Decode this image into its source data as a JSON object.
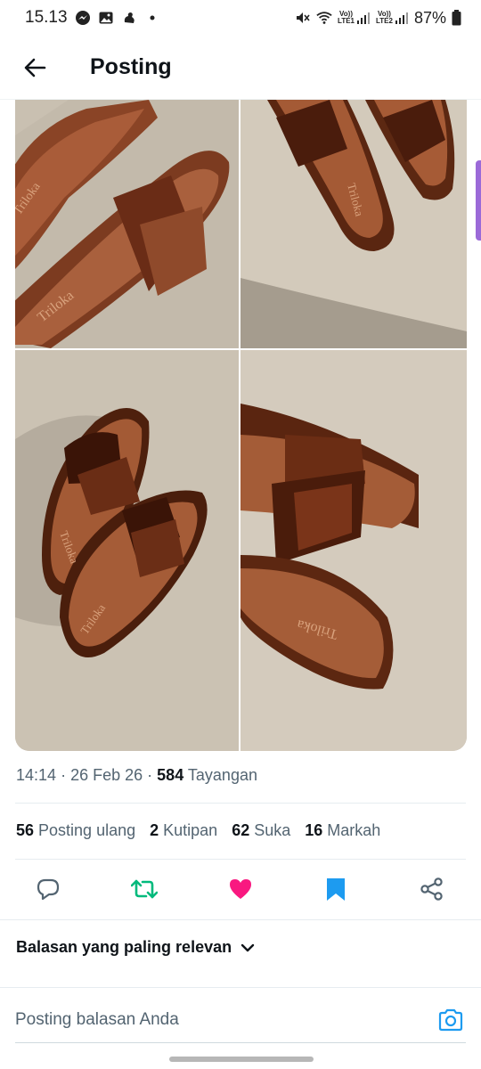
{
  "status_bar": {
    "time": "15.13",
    "battery": "87%",
    "sim1": "LTE1",
    "sim2": "LTE2",
    "volte": "Vo))"
  },
  "header": {
    "back_icon": "arrow-left-icon",
    "title": "Posting"
  },
  "media": {
    "brand_text": "Triloka",
    "photos": [
      "sandal-photo-1",
      "sandal-photo-2",
      "sandal-photo-3",
      "sandal-photo-4"
    ]
  },
  "meta": {
    "time": "14:14",
    "date": "26 Feb 26",
    "views_count": "584",
    "views_label": "Tayangan",
    "sep": "·"
  },
  "stats": [
    {
      "count": "56",
      "label": "Posting ulang"
    },
    {
      "count": "2",
      "label": "Kutipan"
    },
    {
      "count": "62",
      "label": "Suka"
    },
    {
      "count": "16",
      "label": "Markah"
    }
  ],
  "actions": {
    "reply_icon": "reply-bubble-icon",
    "repost_icon": "repost-icon",
    "like_icon": "heart-icon",
    "bookmark_icon": "bookmark-icon",
    "share_icon": "share-icon",
    "repost_color": "#00ba7c",
    "like_color": "#f91880",
    "bookmark_color": "#1d9bf0"
  },
  "sort": {
    "label": "Balasan yang paling relevan",
    "icon": "chevron-down-icon"
  },
  "reply": {
    "placeholder": "Posting balasan Anda",
    "camera_icon": "camera-icon",
    "accent": "#1d9bf0"
  }
}
